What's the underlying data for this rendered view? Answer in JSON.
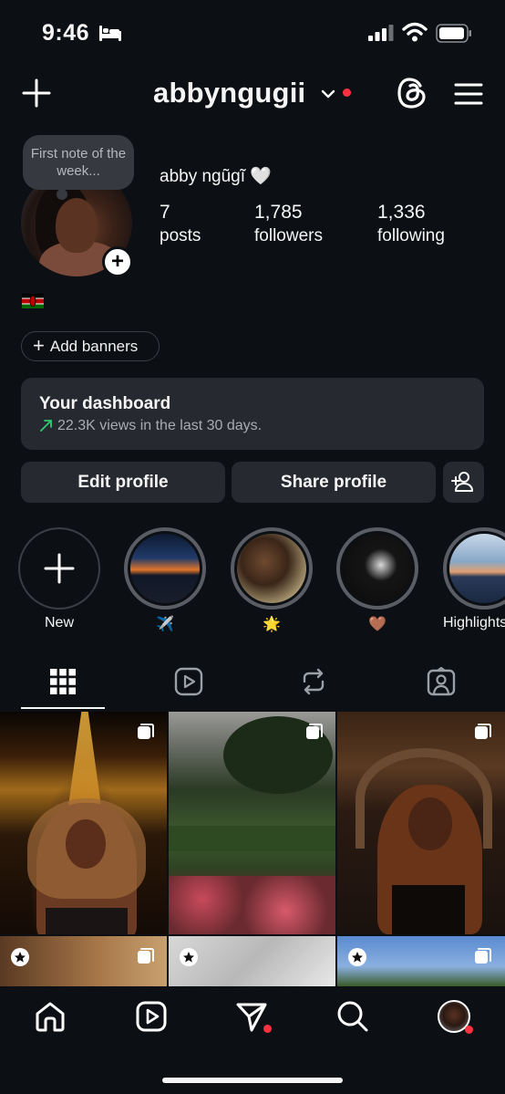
{
  "status_bar": {
    "time": "9:46"
  },
  "header": {
    "username": "abbyngugii"
  },
  "note": {
    "text": "First note of the week..."
  },
  "profile": {
    "display_name": "abby ngũgĩ 🤍",
    "stats": [
      {
        "value": "7",
        "label": "posts"
      },
      {
        "value": "1,785",
        "label": "followers"
      },
      {
        "value": "1,336",
        "label": "following"
      }
    ]
  },
  "banners": {
    "label": "Add banners"
  },
  "dashboard": {
    "title": "Your dashboard",
    "subtitle": "22.3K views in the last 30 days."
  },
  "actions": {
    "edit_label": "Edit profile",
    "share_label": "Share profile"
  },
  "highlights": [
    {
      "label": "New"
    },
    {
      "label": "✈️"
    },
    {
      "label": "🌟"
    },
    {
      "label": "🤎"
    },
    {
      "label": "Highlights"
    }
  ],
  "colors": {
    "background": "#0c1014",
    "card": "#262a30",
    "accent_red": "#ff3040",
    "trend_green": "#2ecc71"
  },
  "icons": [
    "bed-icon",
    "signal-icon",
    "wifi-icon",
    "battery-icon",
    "plus-icon",
    "chevron-down-icon",
    "threads-icon",
    "menu-icon",
    "grid-icon",
    "reels-icon",
    "reposts-icon",
    "tagged-icon",
    "home-icon",
    "reels-nav-icon",
    "direct-icon",
    "search-icon",
    "profile-avatar-icon"
  ]
}
